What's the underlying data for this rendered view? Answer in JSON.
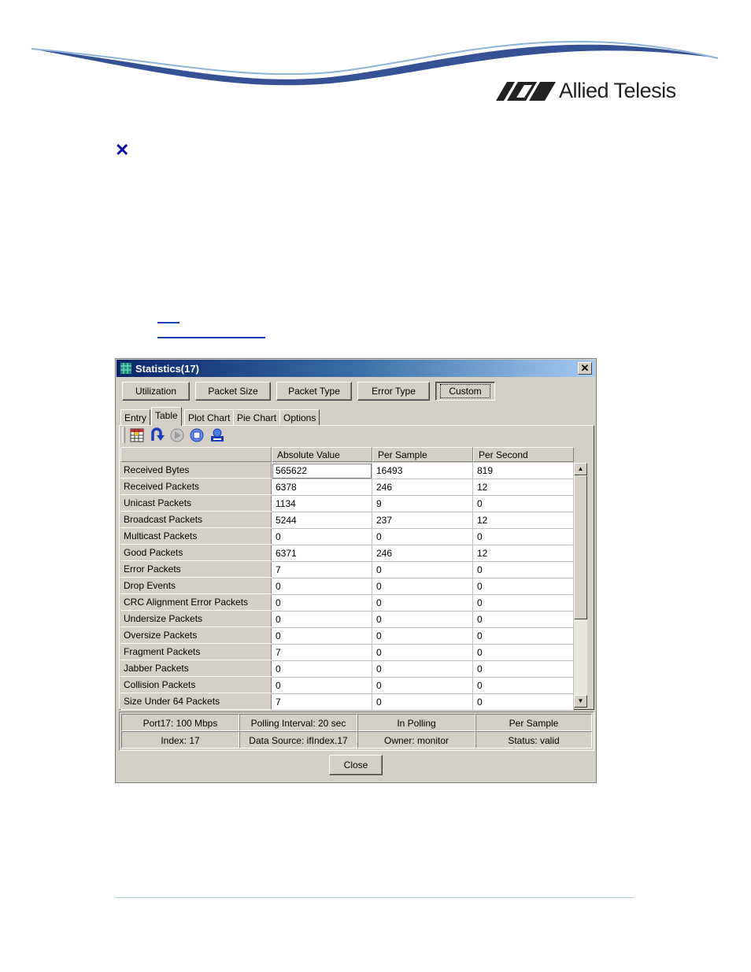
{
  "header": {
    "logo_text": "Allied Telesis"
  },
  "window": {
    "title": "Statistics(17)",
    "close_glyph": "✕",
    "top_buttons": [
      "Utilization",
      "Packet Size",
      "Packet Type",
      "Error Type",
      "Custom"
    ],
    "tabs": [
      "Entry",
      "Table",
      "Plot Chart",
      "Pie Chart",
      "Options"
    ],
    "active_tab": "Table",
    "toolbar_icons": [
      "table-grid-icon",
      "refresh-icon",
      "play-icon",
      "stop-icon",
      "print-icon"
    ],
    "columns": [
      "Absolute Value",
      "Per Sample",
      "Per Second"
    ],
    "rows": [
      {
        "label": "Received Bytes",
        "values": [
          "565622",
          "16493",
          "819"
        ]
      },
      {
        "label": "Received Packets",
        "values": [
          "6378",
          "246",
          "12"
        ]
      },
      {
        "label": "Unicast Packets",
        "values": [
          "1134",
          "9",
          "0"
        ]
      },
      {
        "label": "Broadcast Packets",
        "values": [
          "5244",
          "237",
          "12"
        ]
      },
      {
        "label": "Multicast Packets",
        "values": [
          "0",
          "0",
          "0"
        ]
      },
      {
        "label": "Good Packets",
        "values": [
          "6371",
          "246",
          "12"
        ]
      },
      {
        "label": "Error Packets",
        "values": [
          "7",
          "0",
          "0"
        ]
      },
      {
        "label": "Drop Events",
        "values": [
          "0",
          "0",
          "0"
        ]
      },
      {
        "label": "CRC Alignment Error Packets",
        "values": [
          "0",
          "0",
          "0"
        ]
      },
      {
        "label": "Undersize Packets",
        "values": [
          "0",
          "0",
          "0"
        ]
      },
      {
        "label": "Oversize Packets",
        "values": [
          "0",
          "0",
          "0"
        ]
      },
      {
        "label": "Fragment Packets",
        "values": [
          "7",
          "0",
          "0"
        ]
      },
      {
        "label": "Jabber Packets",
        "values": [
          "0",
          "0",
          "0"
        ]
      },
      {
        "label": "Collision Packets",
        "values": [
          "0",
          "0",
          "0"
        ]
      },
      {
        "label": "Size Under 64 Packets",
        "values": [
          "7",
          "0",
          "0"
        ]
      }
    ],
    "status": [
      [
        "Port17: 100 Mbps",
        "Polling Interval: 20 sec",
        "In Polling",
        "Per Sample"
      ],
      [
        "Index: 17",
        "Data Source: ifIndex.17",
        "Owner: monitor",
        "Status: valid"
      ]
    ],
    "close_button": "Close"
  }
}
